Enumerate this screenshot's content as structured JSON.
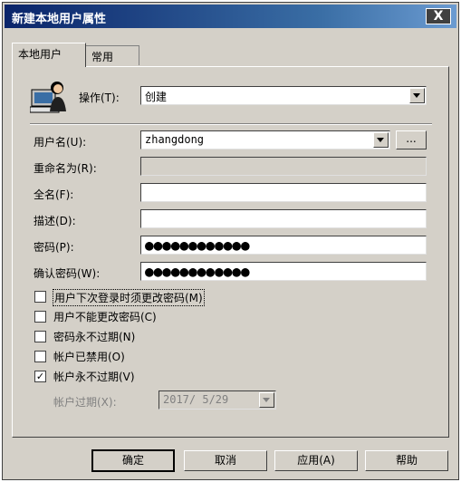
{
  "window": {
    "title": "新建本地用户属性",
    "close_label": "X"
  },
  "tabs": [
    {
      "label": "本地用户",
      "active": true
    },
    {
      "label": "常用",
      "active": false
    }
  ],
  "action": {
    "label": "操作(T):",
    "value": "创建"
  },
  "form": {
    "username": {
      "label": "用户名(U):",
      "value": "zhangdong",
      "browse_label": "..."
    },
    "rename": {
      "label": "重命名为(R):",
      "value": ""
    },
    "fullname": {
      "label": "全名(F):",
      "value": ""
    },
    "description": {
      "label": "描述(D):",
      "value": ""
    },
    "password": {
      "label": "密码(P):",
      "value": "●●●●●●●●●●●●"
    },
    "confirm_password": {
      "label": "确认密码(W):",
      "value": "●●●●●●●●●●●●"
    }
  },
  "options": [
    {
      "label": "用户下次登录时须更改密码(M)",
      "checked": false
    },
    {
      "label": "用户不能更改密码(C)",
      "checked": false
    },
    {
      "label": "密码永不过期(N)",
      "checked": false
    },
    {
      "label": "帐户已禁用(O)",
      "checked": false
    },
    {
      "label": "帐户永不过期(V)",
      "checked": true
    }
  ],
  "expiry": {
    "label": "帐户过期(X):",
    "value": "2017/ 5/29"
  },
  "buttons": {
    "ok": "确定",
    "cancel": "取消",
    "apply": "应用(A)",
    "help": "帮助"
  },
  "check_mark": "✓"
}
